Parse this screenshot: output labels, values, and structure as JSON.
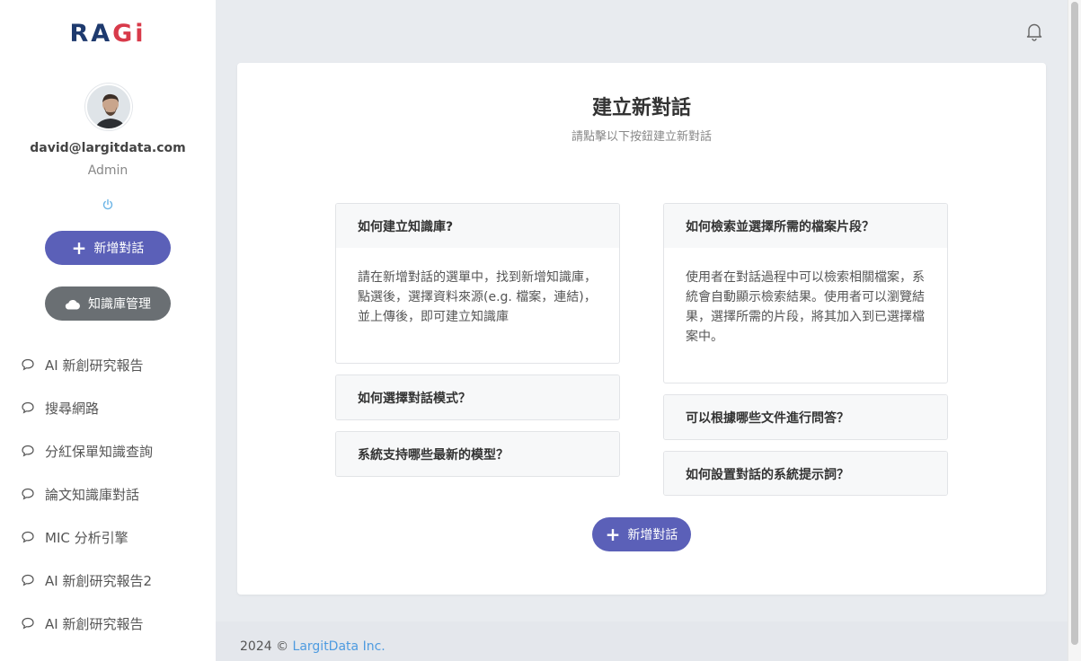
{
  "app": {
    "logo_text_1": "RA",
    "logo_text_2": "G",
    "logo_text_3": "i"
  },
  "user": {
    "email": "david@largitdata.com",
    "role": "Admin"
  },
  "sidebar": {
    "new_chat_label": "新增對話",
    "kb_manage_label": "知識庫管理",
    "items": [
      {
        "label": "AI 新創研究報告"
      },
      {
        "label": "搜尋網路"
      },
      {
        "label": "分紅保單知識查詢"
      },
      {
        "label": "論文知識庫對話"
      },
      {
        "label": "MIC 分析引擎"
      },
      {
        "label": "AI 新創研究報告2"
      },
      {
        "label": "AI 新創研究報告"
      }
    ]
  },
  "main": {
    "title": "建立新對話",
    "subtitle": "請點擊以下按鈕建立新對話",
    "faq_left": [
      {
        "question": "如何建立知識庫?",
        "answer": "請在新增對話的選單中，找到新增知識庫，點選後，選擇資料來源(e.g. 檔案，連結)，並上傳後，即可建立知識庫"
      },
      {
        "question": "如何選擇對話模式？",
        "answer": ""
      },
      {
        "question": "系統支持哪些最新的模型？",
        "answer": ""
      }
    ],
    "faq_right": [
      {
        "question": "如何檢索並選擇所需的檔案片段？",
        "answer": "使用者在對話過程中可以檢索相關檔案，系統會自動顯示檢索結果。使用者可以瀏覽結果，選擇所需的片段，將其加入到已選擇檔案中。"
      },
      {
        "question": "可以根據哪些文件進行問答？",
        "answer": ""
      },
      {
        "question": "如何設置對話的系統提示詞？",
        "answer": ""
      }
    ],
    "new_chat_button": "新增對話"
  },
  "footer": {
    "copyright": "2024 © ",
    "company": "LargitData Inc."
  },
  "colors": {
    "primary": "#5b60b8",
    "secondary": "#6a6f73",
    "link": "#4e9be0",
    "logo_blue": "#1e3a6e",
    "logo_red": "#d83a4a"
  }
}
